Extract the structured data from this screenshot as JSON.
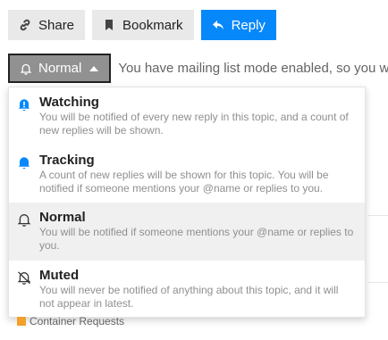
{
  "toolbar": {
    "share": {
      "label": "Share",
      "icon": "link-icon"
    },
    "bookmark": {
      "label": "Bookmark",
      "icon": "bookmark-icon"
    },
    "reply": {
      "label": "Reply",
      "icon": "reply-icon"
    }
  },
  "notifications": {
    "button_label": "Normal",
    "button_icon": "bell-outline-icon",
    "status_text": "You have mailing list mode enabled, so you wi"
  },
  "dropdown": {
    "options": [
      {
        "title": "Watching",
        "desc": "You will be notified of every new reply in this topic, and a count of new replies will be shown.",
        "icon": "bell-exclamation-icon"
      },
      {
        "title": "Tracking",
        "desc": "A count of new replies will be shown for this topic. You will be notified if someone mentions your @name or replies to you.",
        "icon": "bell-filled-icon"
      },
      {
        "title": "Normal",
        "desc": "You will be notified if someone mentions your @name or replies to you.",
        "icon": "bell-outline-icon"
      },
      {
        "title": "Muted",
        "desc": "You will never be notified of anything about this topic, and it will not appear in latest.",
        "icon": "bell-slash-icon"
      }
    ]
  },
  "category": {
    "name": "Container Requests",
    "color": "#f1a02c"
  },
  "colors": {
    "primary": "#0688fa",
    "notif_button": "#919191",
    "alert_blue": "#0688fa"
  }
}
